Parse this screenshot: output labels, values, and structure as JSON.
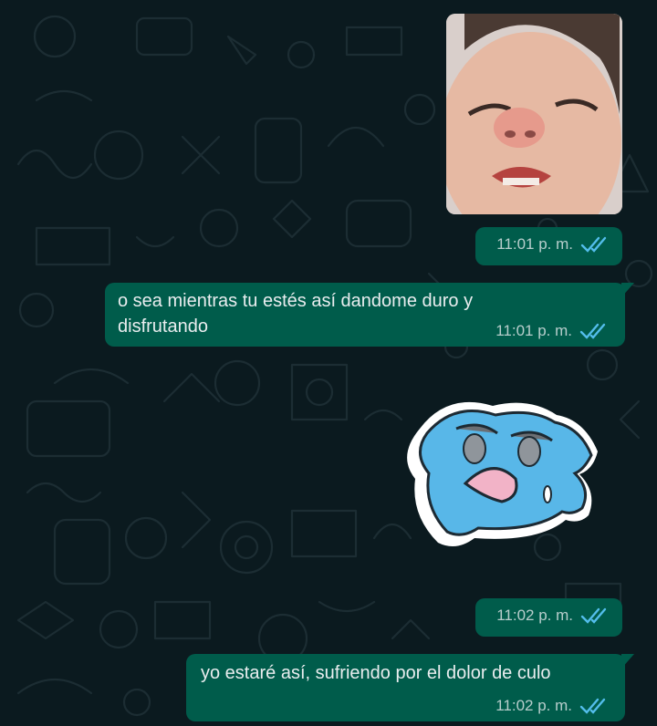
{
  "theme": {
    "background": "#0b1a1f",
    "outgoing_bubble": "#005c4b",
    "read_tick_color": "#53bdeb"
  },
  "messages": [
    {
      "type": "image",
      "description": "photo",
      "time": "11:01 p. m.",
      "status": "read"
    },
    {
      "type": "text",
      "text": "o sea mientras tu estés así dandome duro y disfrutando",
      "time": "11:01 p. m.",
      "status": "read"
    },
    {
      "type": "sticker",
      "description": "sticker",
      "time": "11:02 p. m.",
      "status": "read"
    },
    {
      "type": "text",
      "text": "yo estaré así, sufriendo por el dolor de culo",
      "time": "11:02 p. m.",
      "status": "read"
    }
  ]
}
